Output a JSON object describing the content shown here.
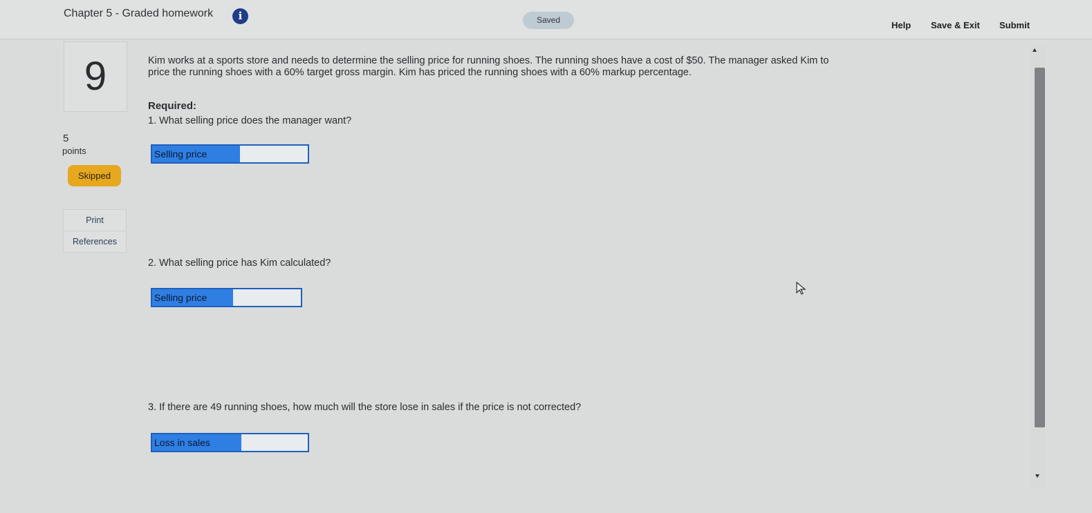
{
  "header": {
    "title": "Chapter 5 - Graded homework",
    "info_icon": "i",
    "status": "Saved",
    "help": "Help",
    "save_exit": "Save & Exit",
    "submit": "Submit"
  },
  "sidebar": {
    "question_number": "9",
    "points_value": "5",
    "points_label": "points",
    "status_badge": "Skipped",
    "print": "Print",
    "references": "References"
  },
  "question": {
    "text": "Kim works at a sports store and needs to determine the selling price for running shoes. The running shoes have a cost of $50. The manager asked Kim to price the running shoes with a 60% target gross margin. Kim has priced the running shoes with a 60% markup percentage.",
    "required": "Required:",
    "parts": [
      {
        "prompt": "1. What selling price does the manager want?",
        "answer_label": "Selling price",
        "value": ""
      },
      {
        "prompt": "2. What selling price has Kim calculated?",
        "answer_label": "Selling price",
        "value": ""
      },
      {
        "prompt": "3. If there are 49 running shoes, how much will the store lose in sales if the price is not corrected?",
        "answer_label": "Loss in sales",
        "value": ""
      }
    ]
  },
  "icons": {
    "info": "info-icon",
    "cursor": "mouse-pointer-icon",
    "scroll_up": "scroll-up-arrow-icon",
    "scroll_down": "scroll-down-arrow-icon"
  },
  "colors": {
    "accent_blue": "#1f5fbd",
    "label_blue": "#2f7fe3",
    "skipped": "#e6a81e",
    "info_icon": "#1f3d8a"
  }
}
